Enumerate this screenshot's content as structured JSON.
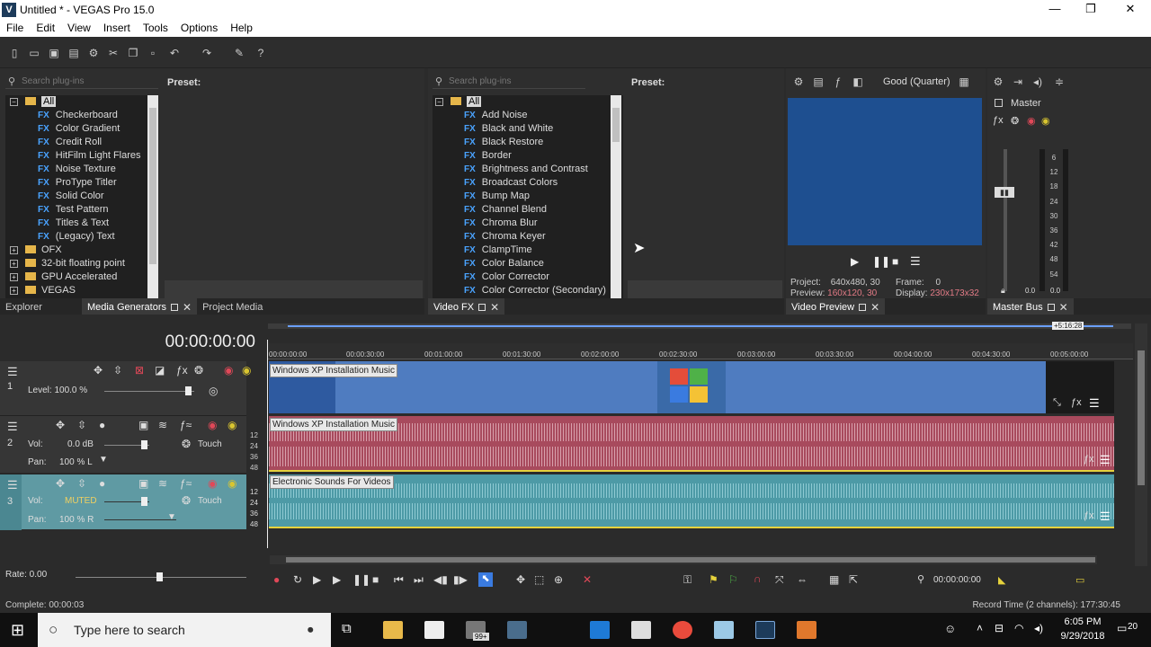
{
  "window": {
    "app_icon": "V",
    "title": "Untitled * - VEGAS Pro 15.0",
    "min": "—",
    "max": "❐",
    "close": "✕"
  },
  "menu": [
    "File",
    "Edit",
    "View",
    "Insert",
    "Tools",
    "Options",
    "Help"
  ],
  "explorer": {
    "search_placeholder": "Search plug-ins",
    "preset_label": "Preset:",
    "root": "All",
    "items": [
      "Checkerboard",
      "Color Gradient",
      "Credit Roll",
      "HitFilm Light Flares",
      "Noise Texture",
      "ProType Titler",
      "Solid Color",
      "Test Pattern",
      "Titles & Text",
      "(Legacy) Text"
    ],
    "folders": [
      "OFX",
      "32-bit floating point",
      "GPU Accelerated",
      "VEGAS"
    ],
    "tabs": [
      "Explorer",
      "Media Generators",
      "Project Media"
    ]
  },
  "videofx": {
    "search_placeholder": "Search plug-ins",
    "preset_label": "Preset:",
    "root": "All",
    "items": [
      "Add Noise",
      "Black and White",
      "Black Restore",
      "Border",
      "Brightness and Contrast",
      "Broadcast Colors",
      "Bump Map",
      "Channel Blend",
      "Chroma Blur",
      "Chroma Keyer",
      "ClampTime",
      "Color Balance",
      "Color Corrector",
      "Color Corrector (Secondary)"
    ],
    "tab": "Video FX"
  },
  "preview": {
    "quality": "Good (Quarter)",
    "project_label": "Project:",
    "project_value": "640x480, 30",
    "frame_label": "Frame:",
    "frame_value": "0",
    "preview_label": "Preview:",
    "preview_value": "160x120, 30",
    "display_label": "Display:",
    "display_value": "230x173x32",
    "tab": "Video Preview"
  },
  "master": {
    "title": "Master",
    "scale": [
      "6",
      "12",
      "18",
      "24",
      "30",
      "36",
      "42",
      "48",
      "54"
    ],
    "levels": [
      "0.0",
      "0.0"
    ],
    "tab": "Master Bus"
  },
  "timeline": {
    "timecode": "00:00:00:00",
    "ruler": [
      "00:00:00:00",
      "00:00:30:00",
      "00:01:00:00",
      "00:01:30:00",
      "00:02:00:00",
      "00:02:30:00",
      "00:03:00:00",
      "00:03:30:00",
      "00:04:00:00",
      "00:04:30:00",
      "00:05:00:00"
    ],
    "end_marker": "+5:16:28",
    "tracks": [
      {
        "num": "1",
        "type": "video",
        "level": "Level: 100.0 %",
        "clip": "Windows XP Installation Music"
      },
      {
        "num": "2",
        "type": "audio",
        "vol_label": "Vol:",
        "vol": "0.0 dB",
        "pan_label": "Pan:",
        "pan": "100 % L",
        "mode": "Touch",
        "meter": [
          "12",
          "24",
          "36",
          "48"
        ],
        "clip": "Windows XP Installation Music"
      },
      {
        "num": "3",
        "type": "audio",
        "vol_label": "Vol:",
        "vol": "MUTED",
        "pan_label": "Pan:",
        "pan": "100 % R",
        "mode": "Touch",
        "meter": [
          "12",
          "24",
          "36",
          "48"
        ],
        "clip": "Electronic Sounds For Videos"
      }
    ],
    "rate": "Rate: 0.00",
    "transport_time": "00:00:00:00"
  },
  "status": {
    "left": "Complete: 00:00:03",
    "right": "Record Time (2 channels): 177:30:45"
  },
  "taskbar": {
    "search_placeholder": "Type here to search",
    "time": "6:05 PM",
    "date": "9/29/2018",
    "notif_count": "20",
    "badge": "99+"
  },
  "colors": {
    "video_track": "#4f7cc0",
    "audio_track_2": "#a84a5d",
    "audio_track_3": "#4d9aa6",
    "preview_bg": "#1e4f90",
    "fx_icon": "#4aa3ff"
  }
}
